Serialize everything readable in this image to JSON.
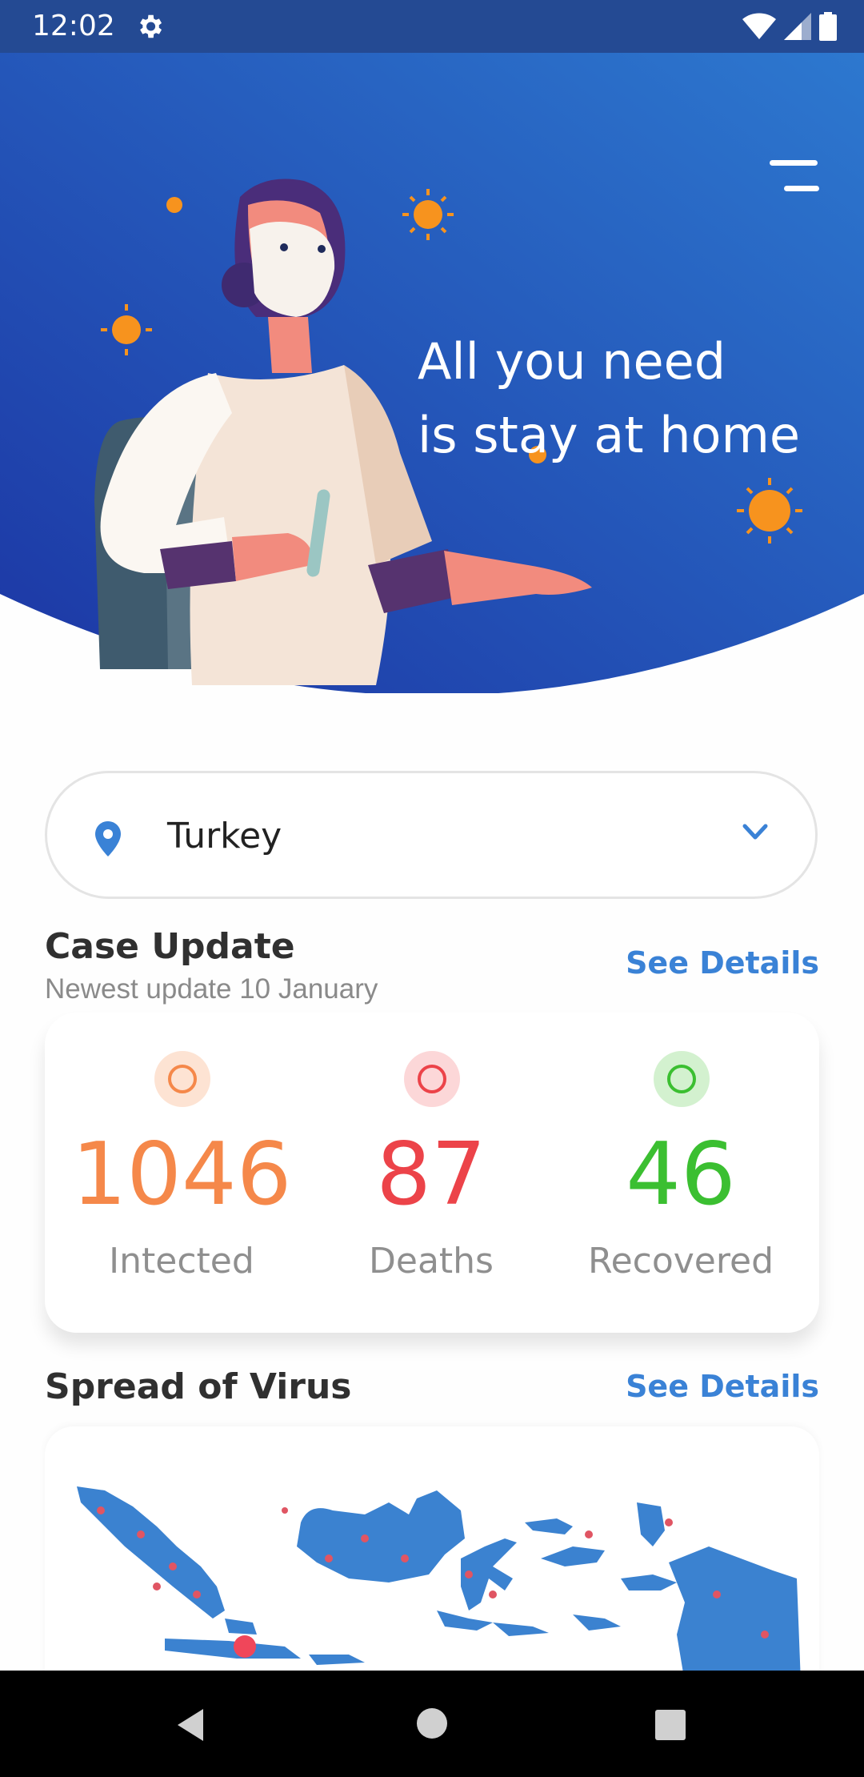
{
  "status_bar": {
    "time": "12:02",
    "icons": [
      "gear-icon",
      "wifi-icon",
      "signal-icon",
      "battery-icon"
    ]
  },
  "header": {
    "menu_icon": "menu-icon",
    "tagline_line1": "All you need",
    "tagline_line2": "is stay at home",
    "illustration": "masked-woman-with-test-tube-illustration"
  },
  "location": {
    "selected_country": "Turkey",
    "pin_icon": "location-pin-icon",
    "dropdown_icon": "chevron-down-icon"
  },
  "case_update": {
    "title": "Case Update",
    "subtitle": "Newest update 10 January",
    "see_details": "See Details",
    "stats": [
      {
        "value": "1046",
        "label": "Intected",
        "color": "#f5884a",
        "dot_bg": "#fde3d3"
      },
      {
        "value": "87",
        "label": "Deaths",
        "color": "#ec4349",
        "dot_bg": "#fcd7d8"
      },
      {
        "value": "46",
        "label": "Recovered",
        "color": "#3bbf31",
        "dot_bg": "#d3f1cf"
      }
    ]
  },
  "spread": {
    "title": "Spread of Virus",
    "see_details": "See Details",
    "map": "indonesia-map"
  },
  "colors": {
    "hero_top": "#2d78cf",
    "hero_bottom": "#1c3aa6",
    "accent": "#3a82d6",
    "map_fill": "#3b82d0"
  },
  "nav": {
    "back": "back-icon",
    "home": "home-icon",
    "recents": "recents-icon"
  }
}
